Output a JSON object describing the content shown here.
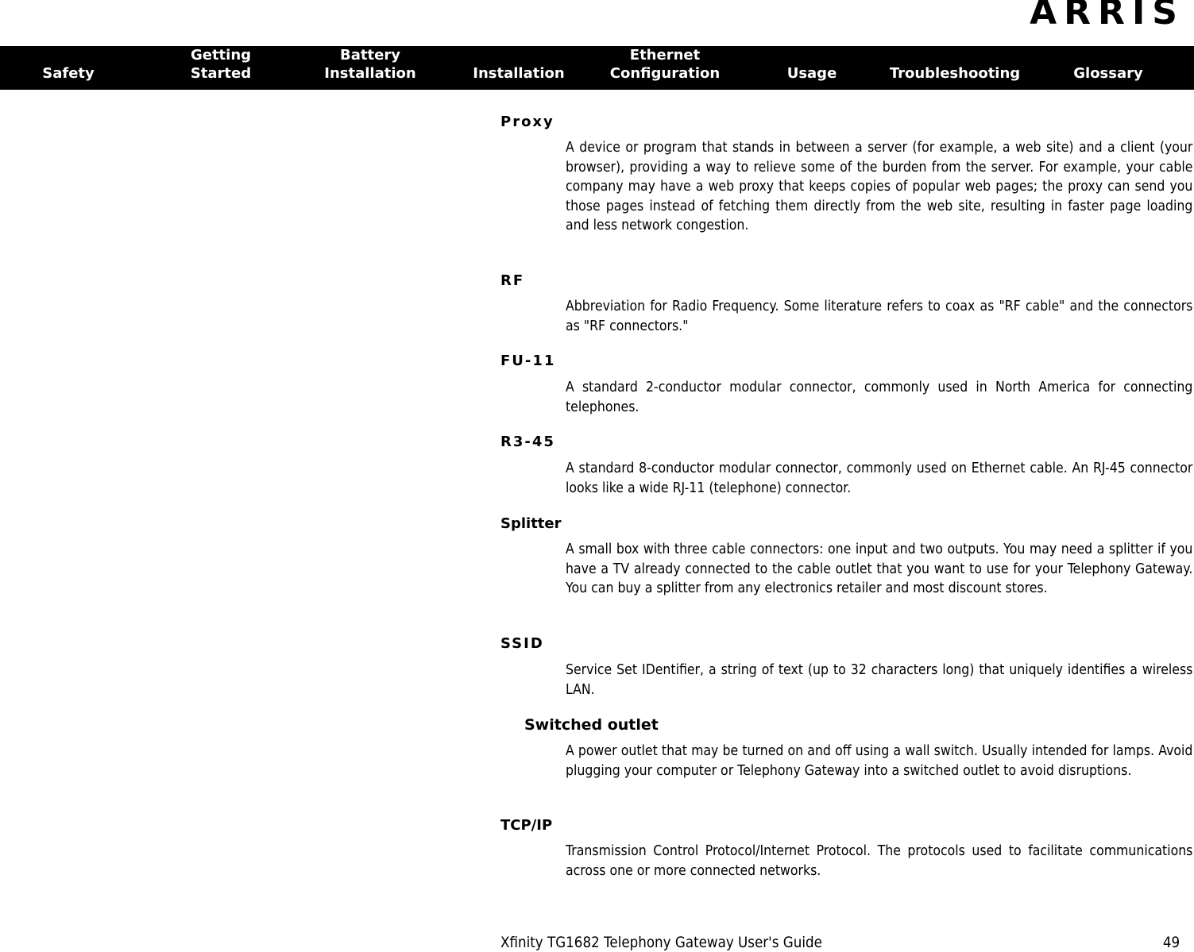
{
  "header": {
    "brand": "ARRIS"
  },
  "nav": {
    "items": [
      {
        "line1": "",
        "line2": "Safety"
      },
      {
        "line1": "Getting",
        "line2": "Started"
      },
      {
        "line1": "Battery",
        "line2": "Installation"
      },
      {
        "line1": "",
        "line2": "Installation"
      },
      {
        "line1": "Ethernet",
        "line2": "Configuration"
      },
      {
        "line1": "",
        "line2": "Usage"
      },
      {
        "line1": "",
        "line2": "Troubleshooting"
      },
      {
        "line1": "",
        "line2": "Glossary"
      }
    ]
  },
  "glossary": {
    "entries": [
      {
        "term": "Proxy",
        "definition": "A device or program that stands in between a server (for example, a web site) and a client (your browser), providing a way to relieve some of the burden from the server. For example, your cable company may have a web proxy that keeps copies of popular web pages; the proxy can send you those pages instead of fetching them directly from the web site, resulting in faster page loading and less network congestion."
      },
      {
        "term": "RF",
        "definition": "Abbreviation for Radio Frequency. Some literature refers to coax as \"RF cable\" and the connectors as \"RF connectors.\""
      },
      {
        "term": "FU-11",
        "definition": "A standard 2-conductor modular connector, commonly used in North America for connecting telephones."
      },
      {
        "term": "R3-45",
        "definition": "A standard 8-conductor modular connector, commonly used on Ethernet cable. An RJ-45 connector looks like a wide RJ-11 (telephone) connector."
      },
      {
        "term": "Splitter",
        "definition": "A small box with three cable connectors: one input and two outputs. You may need a splitter if you have a TV already connected to the cable outlet that you want to use for your Telephony Gateway. You can buy a splitter from any electronics retailer and most discount stores."
      },
      {
        "term": "SSID",
        "definition": "Service Set IDentifier, a string of text (up to 32 characters long) that uniquely identifies a wireless LAN."
      },
      {
        "term": "Switched outlet",
        "definition": "A power outlet that may be turned on and off using a wall switch. Usually intended for lamps. Avoid plugging your computer or Telephony Gateway into a switched outlet to avoid disruptions."
      },
      {
        "term": "TCP/IP",
        "definition": "Transmission Control Protocol/Internet Protocol. The protocols used to facilitate communications across one or more connected networks."
      }
    ]
  },
  "footer": {
    "title": "Xfinity TG1682 Telephony Gateway User's Guide",
    "page_number": "49"
  }
}
